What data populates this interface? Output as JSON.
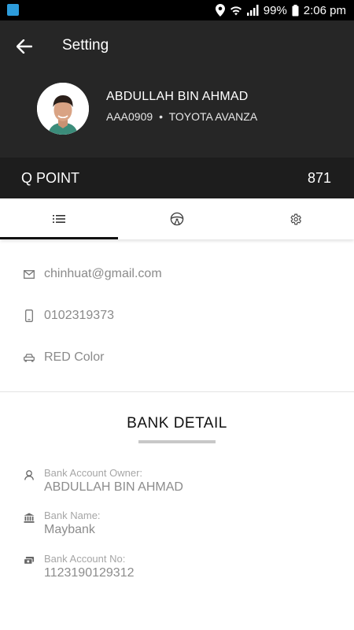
{
  "status_bar": {
    "battery": "99%",
    "time": "2:06 pm"
  },
  "header": {
    "title": "Setting"
  },
  "profile": {
    "name": "ABDULLAH BIN AHMAD",
    "plate": "AAA0909",
    "separator": "•",
    "vehicle": "TOYOTA AVANZA"
  },
  "qpoint": {
    "label": "Q POINT",
    "value": "871"
  },
  "tabs": [
    {
      "icon": "list-icon",
      "active": true
    },
    {
      "icon": "steering-wheel-icon",
      "active": false
    },
    {
      "icon": "gear-icon",
      "active": false
    }
  ],
  "contact": {
    "email": "chinhuat@gmail.com",
    "phone": "0102319373",
    "car_color": "RED Color"
  },
  "bank": {
    "title": "BANK DETAIL",
    "owner_label": "Bank Account Owner:",
    "owner_value": "ABDULLAH BIN AHMAD",
    "name_label": "Bank Name:",
    "name_value": "Maybank",
    "account_label": "Bank Account No:",
    "account_value": "1123190129312"
  },
  "colors": {
    "header_bg": "#262626",
    "qpoint_bg": "#1d1d1d",
    "muted_text": "#8a8a8a"
  }
}
